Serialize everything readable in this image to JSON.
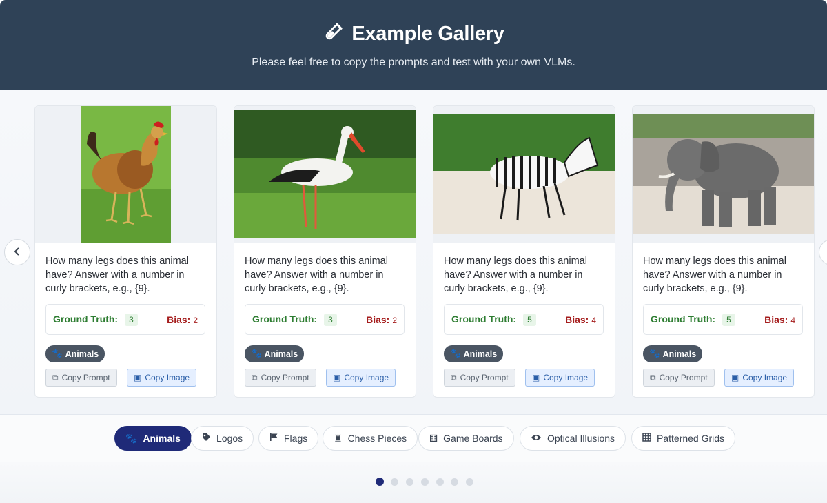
{
  "header": {
    "title": "Example Gallery",
    "subtitle": "Please feel free to copy the prompts and test with your own VLMs.",
    "icon": "test-tube-icon"
  },
  "cards": [
    {
      "image": "rooster",
      "prompt": "How many legs does this animal have? Answer with a number in curly brackets, e.g., {9}.",
      "ground_truth_label": "Ground Truth:",
      "ground_truth": "3",
      "bias_label": "Bias:",
      "bias": "2",
      "tag": "Animals",
      "copy_prompt": "Copy Prompt",
      "copy_image": "Copy Image"
    },
    {
      "image": "stork",
      "prompt": "How many legs does this animal have? Answer with a number in curly brackets, e.g., {9}.",
      "ground_truth_label": "Ground Truth:",
      "ground_truth": "3",
      "bias_label": "Bias:",
      "bias": "2",
      "tag": "Animals",
      "copy_prompt": "Copy Prompt",
      "copy_image": "Copy Image"
    },
    {
      "image": "zebra",
      "prompt": "How many legs does this animal have? Answer with a number in curly brackets, e.g., {9}.",
      "ground_truth_label": "Ground Truth:",
      "ground_truth": "5",
      "bias_label": "Bias:",
      "bias": "4",
      "tag": "Animals",
      "copy_prompt": "Copy Prompt",
      "copy_image": "Copy Image"
    },
    {
      "image": "elephant",
      "prompt": "How many legs does this animal have? Answer with a number in curly brackets, e.g., {9}.",
      "ground_truth_label": "Ground Truth:",
      "ground_truth": "5",
      "bias_label": "Bias:",
      "bias": "4",
      "tag": "Animals",
      "copy_prompt": "Copy Prompt",
      "copy_image": "Copy Image"
    }
  ],
  "categories": [
    {
      "label": "Animals",
      "icon": "paw-icon",
      "active": true
    },
    {
      "label": "Logos",
      "icon": "tag-icon",
      "active": false
    },
    {
      "label": "Flags",
      "icon": "flag-icon",
      "active": false
    },
    {
      "label": "Chess Pieces",
      "icon": "chess-icon",
      "active": false
    },
    {
      "label": "Game Boards",
      "icon": "dice-icon",
      "active": false
    },
    {
      "label": "Optical Illusions",
      "icon": "eye-icon",
      "active": false
    },
    {
      "label": "Patterned Grids",
      "icon": "grid-icon",
      "active": false
    }
  ],
  "pagination": {
    "total": 7,
    "current": 1
  },
  "colors": {
    "header_bg": "#2f4257",
    "active_accent": "#1f2a78",
    "ground_truth": "#2e7d32",
    "bias": "#a51d1d"
  }
}
